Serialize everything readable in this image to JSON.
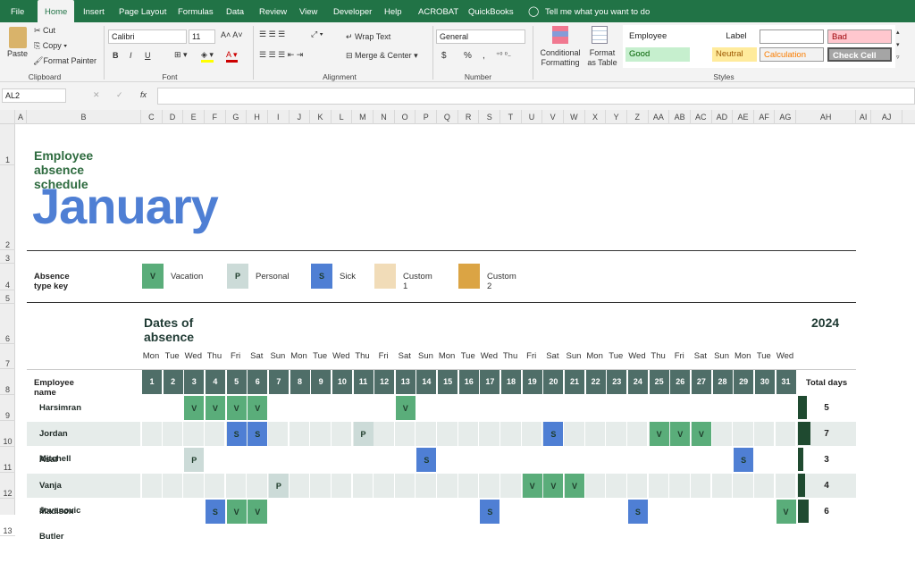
{
  "tabs": [
    "File",
    "Home",
    "Insert",
    "Page Layout",
    "Formulas",
    "Data",
    "Review",
    "View",
    "Developer",
    "Help",
    "ACROBAT",
    "QuickBooks"
  ],
  "tell_me": "Tell me what you want to do",
  "ribbon": {
    "clipboard": {
      "paste": "Paste",
      "cut": "Cut",
      "copy": "Copy",
      "format_painter": "Format Painter",
      "label": "Clipboard"
    },
    "font": {
      "name": "Calibri",
      "size": "11",
      "bold": "B",
      "italic": "I",
      "underline": "U",
      "label": "Font"
    },
    "alignment": {
      "wrap": "Wrap Text",
      "merge": "Merge & Center",
      "label": "Alignment"
    },
    "number": {
      "format": "General",
      "currency": "$",
      "percent": "%",
      "comma": ",",
      "label": "Number"
    },
    "styles": {
      "conditional": "Conditional Formatting",
      "format_table": "Format as Table",
      "label": "Styles",
      "cells": [
        {
          "t": "Employee",
          "bg": "#ffffff",
          "c": "#222222"
        },
        {
          "t": "Label",
          "bg": "#ffffff",
          "c": "#222222"
        },
        {
          "t": "",
          "bg": "#ffffff",
          "c": "#222222"
        },
        {
          "t": "Bad",
          "bg": "#ffc7ce",
          "c": "#9c0006"
        },
        {
          "t": "Good",
          "bg": "#c6efce",
          "c": "#006100"
        },
        {
          "t": "Neutral",
          "bg": "#ffeb9c",
          "c": "#9c5700"
        },
        {
          "t": "Calculation",
          "bg": "#f2f2f2",
          "c": "#fa7d00"
        },
        {
          "t": "Check Cell",
          "bg": "#a5a5a5",
          "c": "#ffffff"
        }
      ]
    }
  },
  "formula_bar": {
    "name_box": "AL2",
    "fx": "fx",
    "value": ""
  },
  "columns": [
    "A",
    "B",
    "C",
    "D",
    "E",
    "F",
    "G",
    "H",
    "I",
    "J",
    "K",
    "L",
    "M",
    "N",
    "O",
    "P",
    "Q",
    "R",
    "S",
    "T",
    "U",
    "V",
    "W",
    "X",
    "Y",
    "Z",
    "AA",
    "AB",
    "AC",
    "AD",
    "AE",
    "AF",
    "AG",
    "AH",
    "AI",
    "AJ"
  ],
  "rows": [
    "1",
    "2",
    "3",
    "4",
    "5",
    "6",
    "7",
    "8",
    "9",
    "10",
    "11",
    "12",
    "13"
  ],
  "sheet": {
    "subtitle": "Employee absence schedule",
    "month": "January",
    "key_label": "Absence type key",
    "key": [
      {
        "code": "V",
        "label": "Vacation",
        "color": "#5aad7a"
      },
      {
        "code": "P",
        "label": "Personal",
        "color": "#ccdbd8"
      },
      {
        "code": "S",
        "label": "Sick",
        "color": "#4f7fd4"
      },
      {
        "code": "",
        "label": "Custom 1",
        "color": "#f1dcb8"
      },
      {
        "code": "",
        "label": "Custom 2",
        "color": "#dba444"
      }
    ],
    "dates_title": "Dates of absence",
    "year": "2024",
    "day_names": [
      "Mon",
      "Tue",
      "Wed",
      "Thu",
      "Fri",
      "Sat",
      "Sun",
      "Mon",
      "Tue",
      "Wed",
      "Thu",
      "Fri",
      "Sat",
      "Sun",
      "Mon",
      "Tue",
      "Wed",
      "Thu",
      "Fri",
      "Sat",
      "Sun",
      "Mon",
      "Tue",
      "Wed",
      "Thu",
      "Fri",
      "Sat",
      "Sun",
      "Mon",
      "Tue",
      "Wed"
    ],
    "days": [
      "1",
      "2",
      "3",
      "4",
      "5",
      "6",
      "7",
      "8",
      "9",
      "10",
      "11",
      "12",
      "13",
      "14",
      "15",
      "16",
      "17",
      "18",
      "19",
      "20",
      "21",
      "22",
      "23",
      "24",
      "25",
      "26",
      "27",
      "28",
      "29",
      "30",
      "31"
    ],
    "employee_header": "Employee name",
    "total_header": "Total days",
    "employees": [
      {
        "name": "Harsimran Brar",
        "absences": {
          "3": "V",
          "4": "V",
          "5": "V",
          "6": "V",
          "13": "V"
        },
        "total": "5"
      },
      {
        "name": "Jordan Mitchell",
        "absences": {
          "5": "S",
          "6": "S",
          "11": "P",
          "20": "S",
          "25": "V",
          "26": "V",
          "27": "V"
        },
        "total": "7"
      },
      {
        "name": "Asaf Karten",
        "absences": {
          "3": "P",
          "14": "S",
          "29": "S"
        },
        "total": "3"
      },
      {
        "name": "Vanja Jovanovic",
        "absences": {
          "7": "P",
          "19": "V",
          "20": "V",
          "21": "V"
        },
        "total": "4"
      },
      {
        "name": "Madison Butler",
        "absences": {
          "4": "S",
          "5": "V",
          "6": "V",
          "17": "S",
          "24": "S",
          "31": "V"
        },
        "total": "6"
      }
    ]
  },
  "colors": {
    "accent": "#217346",
    "header_day": "#4f6e68",
    "title_green": "#2e6b3f",
    "month_blue": "#4f7fd4",
    "total_bar": "#1f4a30"
  }
}
